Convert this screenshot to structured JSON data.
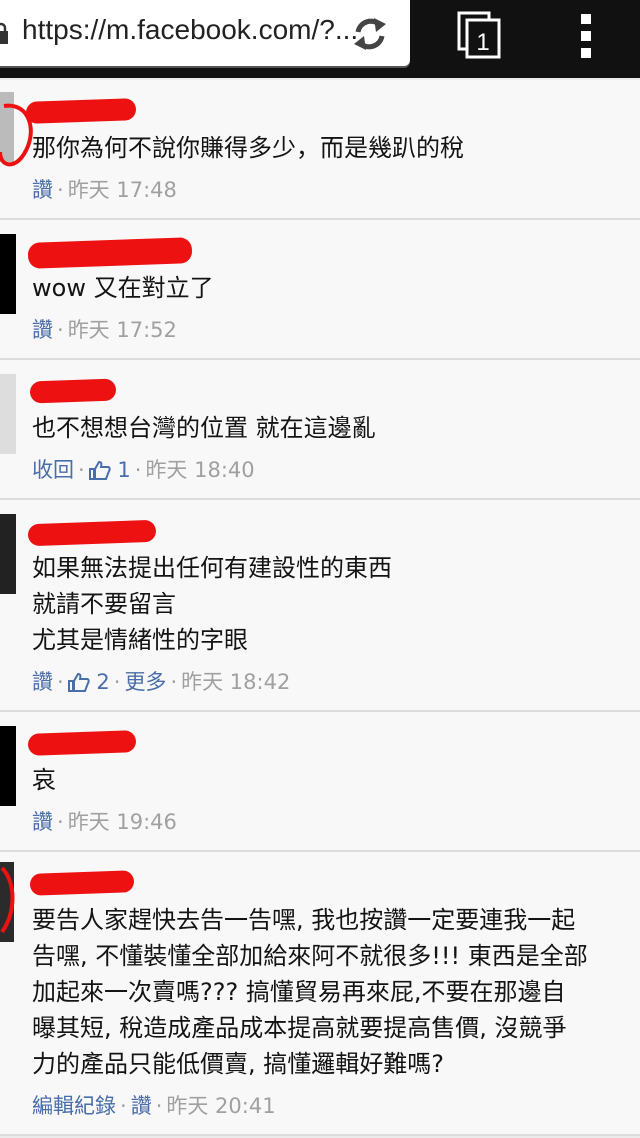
{
  "browser": {
    "url": "https://m.facebook.com/?...",
    "tab_count": "1"
  },
  "icons": {
    "lock": "lock-icon",
    "reload": "reload-icon",
    "tabs": "tabs-icon",
    "menu": "overflow-menu-icon",
    "like": "thumbs-up-icon"
  },
  "colors": {
    "link": "#4a6ea9",
    "meta": "#a0a0a0",
    "redaction": "#ee1111"
  },
  "comments": [
    {
      "text": "那你為何不說你賺得多少，而是幾趴的稅",
      "like": "讚",
      "time": "昨天 17:48"
    },
    {
      "text": "wow 又在對立了",
      "like": "讚",
      "time": "昨天 17:52"
    },
    {
      "text": "也不想想台灣的位置 就在這邊亂",
      "like": "收回",
      "likes": "1",
      "time": "昨天 18:40"
    },
    {
      "text": "如果無法提出任何有建設性的東西\n就請不要留言\n尤其是情緒性的字眼",
      "like": "讚",
      "likes": "2",
      "more": "更多",
      "time": "昨天 18:42"
    },
    {
      "text": "哀",
      "like": "讚",
      "time": "昨天 19:46"
    },
    {
      "text": "要告人家趕快去告一告嘿, 我也按讚一定要連我一起\n告嘿, 不懂裝懂全部加給來阿不就很多!!! 東西是全部\n加起來一次賣嗎??? 搞懂貿易再來屁,不要在那邊自\n曝其短, 稅造成產品成本提高就要提高售價, 沒競爭\n力的產品只能低價賣, 搞懂邏輯好難嗎?",
      "edit": "編輯紀錄",
      "like": "讚",
      "time": "昨天 20:41"
    }
  ]
}
